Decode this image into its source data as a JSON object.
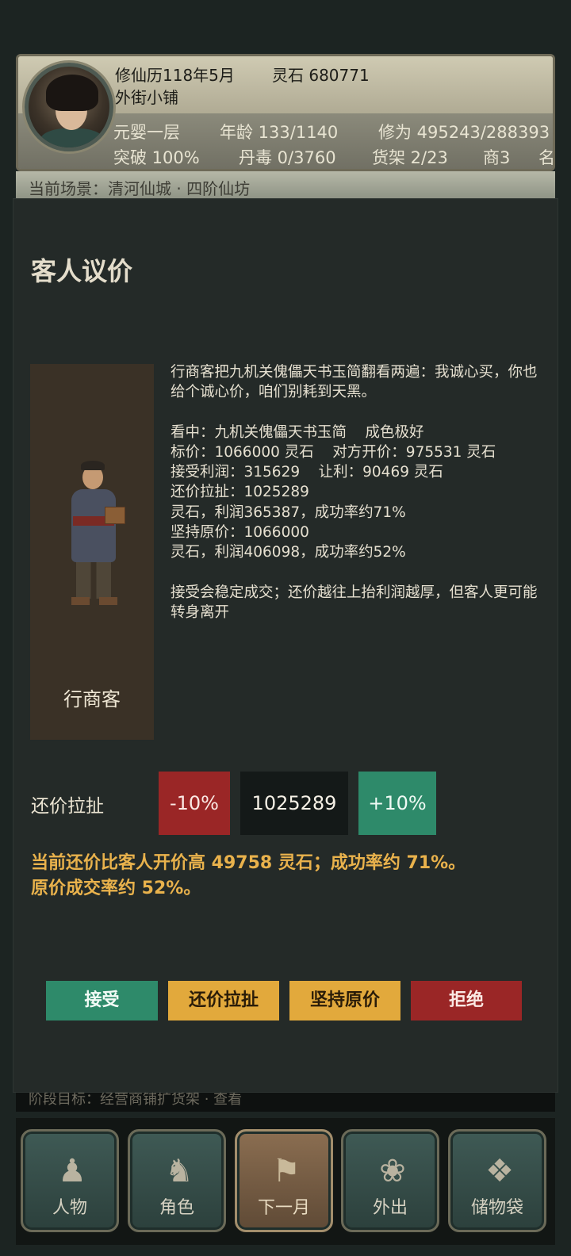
{
  "header": {
    "date": "修仙历118年5月",
    "spirit_stones": "灵石 680771",
    "location": "外街小铺",
    "stats_row1": [
      "元婴一层",
      "年龄 133/1140",
      "修为 495243/288393"
    ],
    "stats_row2": [
      "突破 100%",
      "丹毒 0/3760",
      "货架 2/23",
      "商3",
      "名望"
    ]
  },
  "scene": {
    "text": "当前场景：清河仙城 · 四阶仙坊"
  },
  "dialog": {
    "title": "客人议价",
    "customer": {
      "name": "行商客"
    },
    "story": {
      "intro": "行商客把九机关傀儡天书玉简翻看两遍：我诚心买，你也给个诚心价，咱们别耗到天黑。",
      "item_line": "看中：九机关傀儡天书玉简    成色极好",
      "price_line": "标价：1066000 灵石    对方开价：975531 灵石",
      "profit_line": "接受利润：315629    让利：90469 灵石",
      "counter_line1": "还价拉扯：1025289",
      "counter_line2": "灵石，利润365387，成功率约71%",
      "insist_line1": "坚持原价：1066000",
      "insist_line2": "灵石，利润406098，成功率约52%",
      "footer": "接受会稳定成交；还价越往上抬利润越厚，但客人更可能转身离开"
    },
    "counter": {
      "label": "还价拉扯",
      "minus": "-10%",
      "value": "1025289",
      "plus": "+10%"
    },
    "hint": "当前还价比客人开价高 49758 灵石；成功率约 71%。原价成交率约 52%。",
    "actions": {
      "accept": "接受",
      "counter": "还价拉扯",
      "insist": "坚持原价",
      "reject": "拒绝"
    }
  },
  "objective": {
    "text": "阶段目标：经营商铺扩货架 · 查看"
  },
  "nav": [
    {
      "label": "人物",
      "icon": "person-icon"
    },
    {
      "label": "角色",
      "icon": "robe-character-icon"
    },
    {
      "label": "下一月",
      "icon": "flag-icon"
    },
    {
      "label": "外出",
      "icon": "travel-icon"
    },
    {
      "label": "储物袋",
      "icon": "bag-icon"
    }
  ],
  "colors": {
    "background": "#1c2422",
    "dialog": "#242a28",
    "accept_green": "#2e8a6a",
    "gold": "#e2a93c",
    "reject_red": "#9a2626",
    "hint_orange": "#e9b24c"
  }
}
